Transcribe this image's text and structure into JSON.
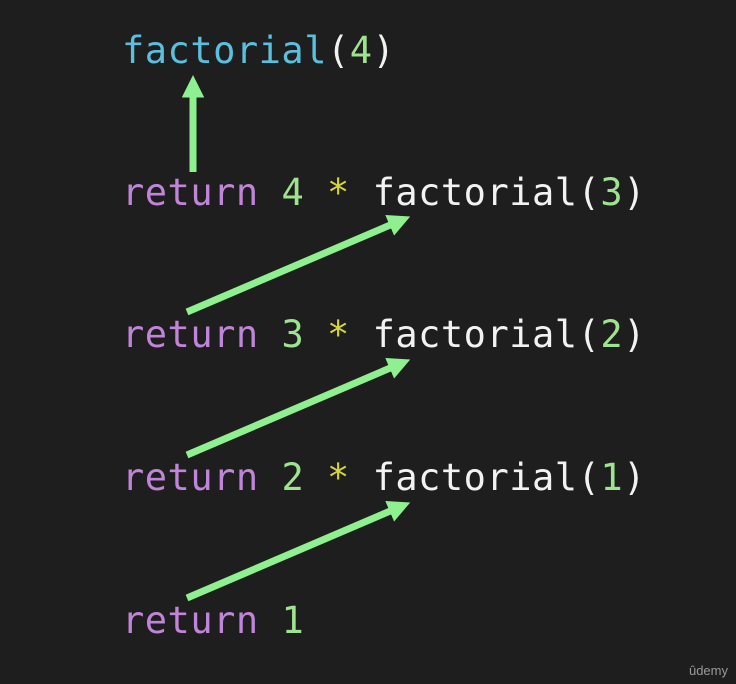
{
  "diagram": {
    "lines": [
      {
        "id": "call",
        "tokens": [
          {
            "text": "factorial",
            "kind": "fn-blue"
          },
          {
            "text": "(",
            "kind": "plain"
          },
          {
            "text": "4",
            "kind": "num"
          },
          {
            "text": ")",
            "kind": "plain"
          }
        ]
      },
      {
        "id": "return-4",
        "tokens": [
          {
            "text": "return",
            "kind": "kw"
          },
          {
            "text": " ",
            "kind": "plain"
          },
          {
            "text": "4",
            "kind": "num"
          },
          {
            "text": " ",
            "kind": "plain"
          },
          {
            "text": "*",
            "kind": "op"
          },
          {
            "text": " ",
            "kind": "plain"
          },
          {
            "text": "factorial",
            "kind": "plain"
          },
          {
            "text": "(",
            "kind": "plain"
          },
          {
            "text": "3",
            "kind": "num"
          },
          {
            "text": ")",
            "kind": "plain"
          }
        ]
      },
      {
        "id": "return-3",
        "tokens": [
          {
            "text": "return",
            "kind": "kw"
          },
          {
            "text": " ",
            "kind": "plain"
          },
          {
            "text": "3",
            "kind": "num"
          },
          {
            "text": " ",
            "kind": "plain"
          },
          {
            "text": "*",
            "kind": "op"
          },
          {
            "text": " ",
            "kind": "plain"
          },
          {
            "text": "factorial",
            "kind": "plain"
          },
          {
            "text": "(",
            "kind": "plain"
          },
          {
            "text": "2",
            "kind": "num"
          },
          {
            "text": ")",
            "kind": "plain"
          }
        ]
      },
      {
        "id": "return-2",
        "tokens": [
          {
            "text": "return",
            "kind": "kw"
          },
          {
            "text": " ",
            "kind": "plain"
          },
          {
            "text": "2",
            "kind": "num"
          },
          {
            "text": " ",
            "kind": "plain"
          },
          {
            "text": "*",
            "kind": "op"
          },
          {
            "text": " ",
            "kind": "plain"
          },
          {
            "text": "factorial",
            "kind": "plain"
          },
          {
            "text": "(",
            "kind": "plain"
          },
          {
            "text": "1",
            "kind": "num"
          },
          {
            "text": ")",
            "kind": "plain"
          }
        ]
      },
      {
        "id": "return-1",
        "tokens": [
          {
            "text": "return",
            "kind": "kw"
          },
          {
            "text": " ",
            "kind": "plain"
          },
          {
            "text": "1",
            "kind": "num"
          }
        ]
      }
    ],
    "arrow_color": "#8ef08e"
  },
  "watermark": {
    "text": "ûdemy"
  }
}
